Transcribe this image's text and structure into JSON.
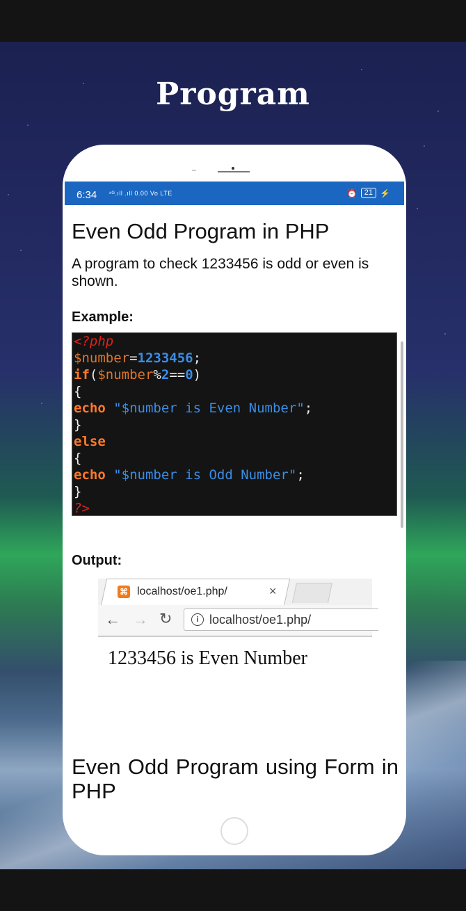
{
  "headline": "Program",
  "status_bar": {
    "time": "6:34",
    "network": "⁴ᴳ.ıll .ıll 0.00 Vo LTE",
    "battery": "21"
  },
  "article": {
    "title": "Even Odd Program in PHP",
    "description": "A program to check 1233456 is odd or even is shown.",
    "example_label": "Example:",
    "code_lines": [
      "<?php",
      "$number=1233456;",
      "if($number%2==0)",
      "{",
      "echo \"$number is Even Number\";",
      "}",
      "else",
      "{",
      "echo \"$number is Odd Number\";",
      "}",
      "?>"
    ],
    "output_label": "Output:",
    "browser": {
      "tab_title": "localhost/oe1.php/",
      "url": "localhost/oe1.php/"
    },
    "output_text": "1233456 is Even Number",
    "next_heading": "Even Odd Program using Form in PHP"
  },
  "colors": {
    "status_bar": "#1a66c0",
    "code_bg": "#141414",
    "keyword": "#ff7a2a",
    "variable": "#e0762a",
    "number": "#3a8de6",
    "php_tag": "#e0211b"
  }
}
